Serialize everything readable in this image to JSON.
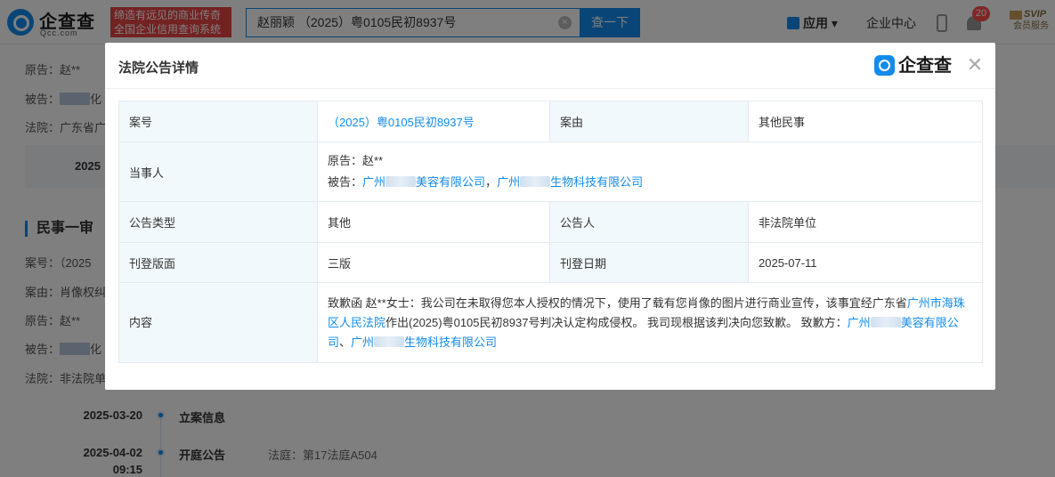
{
  "header": {
    "logo_name": "企查查",
    "logo_sub": "Qcc.com",
    "slogan_line1": "缔造有远见的商业传奇",
    "slogan_line2": "全国企业信用查询系统",
    "search_value": "赵丽颖 （2025）粤0105民初8937号",
    "search_button": "查一下",
    "app_menu": "应用",
    "enterprise_center": "企业中心",
    "notification_count": "20",
    "svip_title": "SVIP",
    "svip_sub": "会员服务"
  },
  "background": {
    "plaintiff_1": "原告：赵**",
    "defendant_1_prefix": "被告：",
    "defendant_1_suffix": "化",
    "court_1": "法院：广东省广",
    "date_1": "2025",
    "section_title": "民事一审",
    "case_no_2": "案号：（2025",
    "cause_2": "案由：肖像权纠",
    "plaintiff_2": "原告：赵**",
    "defendant_2_prefix": "被告：",
    "defendant_2_suffix": "化",
    "court_2": "法院：非法院单",
    "timeline": [
      {
        "date": "2025-03-20",
        "time": "",
        "title": "立案信息",
        "note": ""
      },
      {
        "date": "2025-04-02",
        "time": "09:15",
        "title": "开庭公告",
        "note": "法庭：第17法庭A504"
      }
    ]
  },
  "modal": {
    "title": "法院公告详情",
    "logo_name": "企查查",
    "close_symbol": "✕",
    "rows": {
      "case_no_label": "案号",
      "case_no_value": "（2025）粤0105民初8937号",
      "cause_label": "案由",
      "cause_value": "其他民事",
      "parties_label": "当事人",
      "plaintiff_line": "原告：赵**",
      "defendant_prefix": "被告：",
      "defendant_1a": "广州",
      "defendant_1b": "美容有限公司",
      "defendant_sep": "，",
      "defendant_2a": "广州",
      "defendant_2b": "生物科技有限公司",
      "notice_type_label": "公告类型",
      "notice_type_value": "其他",
      "announcer_label": "公告人",
      "announcer_value": "非法院单位",
      "edition_label": "刊登版面",
      "edition_value": "三版",
      "pub_date_label": "刊登日期",
      "pub_date_value": "2025-07-11",
      "content_label": "内容",
      "content_part1": "致歉函 赵**女士：我公司在未取得您本人授权的情况下，使用了载有您肖像的图片进行商业宣传，该事宜经广东省",
      "content_court_link": "广州市海珠区人民法院",
      "content_part2": "作出(2025)粤0105民初8937号判决认定构成侵权。 我司现根据该判决向您致歉。 致歉方：",
      "content_company1a": "广州",
      "content_company1b": "美容有限公司",
      "content_sep": "、",
      "content_company2a": "广州",
      "content_company2b": "生物科技有限公司"
    }
  }
}
